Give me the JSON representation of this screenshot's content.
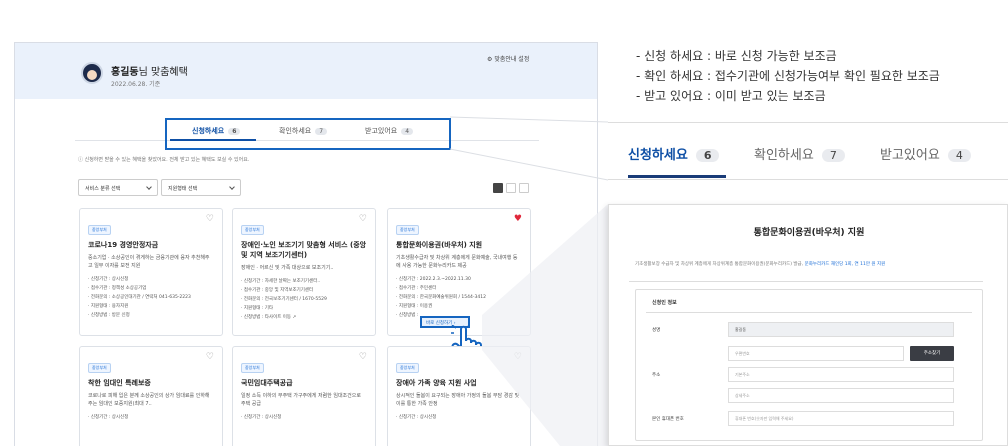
{
  "screen": {
    "header": {
      "name": "홍길동",
      "name_suffix": "님 맞춤혜택",
      "date": "2022.06.28. 기준",
      "guide_link": "맞춤안내 설정"
    },
    "tabs": [
      {
        "label": "신청하세요",
        "count": "6"
      },
      {
        "label": "확인하세요",
        "count": "7"
      },
      {
        "label": "받고있어요",
        "count": "4"
      }
    ],
    "notice": "ⓘ 신청하면 받을 수 있는 혜택을 찾았어요. 전체 받고 있는 혜택도 보실 수 있어요.",
    "filters": {
      "service": "서비스 분류 선택",
      "support": "지원형태 선택"
    },
    "cards": [
      {
        "tag": "중앙부처",
        "title": "코로나19 경영안정자금",
        "desc": "중소기업 · 소상공인이 겪게하는 금융기관에 융자 추천해주고 일부 이자를 보전 지원",
        "rows": [
          "· 신청기간 : 상시신청",
          "· 접수기관 : 정책성 소상공기업",
          "· 전화문의 : 소상공인대기관 / 연락처 041-635-2223",
          "· 지원형태 : 융자지원",
          "· 신청방법 : 방문 신청"
        ]
      },
      {
        "tag": "중앙부처",
        "title": "장애인·노인 보조기기 맞춤형 서비스 (중앙 및 지역 보조기기센터)",
        "desc": "장애인 · 어르신 및 가족 대상으로 보조기기..",
        "rows": [
          "· 신청기간 : 자세한 날짜는 보조기기센터..",
          "· 접수기관 : 중앙 및 지역보조기기센터",
          "· 전화문의 : 전국보조기기센터 / 1670-5529",
          "· 지원형태 : 기타",
          "· 신청방법 : 타사이트 이동 ↗"
        ]
      },
      {
        "tag": "중앙부처",
        "title": "통합문화이용권(바우처) 지원",
        "desc": "기초생활수급자 및 차상위 계층에게 문화예술, 국내여행 등에 사용 가능한 문화누리카드 제공",
        "rows": [
          "· 신청기간 : 2022.2.3.~2022.11.30",
          "· 접수기관 : 주민센터",
          "· 전화문의 : 한국문화예술위원회 / 1544-3412",
          "· 지원형태 : 이용권",
          "· 신청방법 : "
        ],
        "apply_btn": "바로 신청하기 ›",
        "liked": true
      },
      {
        "tag": "중앙부처",
        "title": "착한 임대인 특례보증",
        "desc": "코로나로 피해 입은 분께 소상공인의 상가 임대료를 인하해주는 임대인 보증지원(최대 7..",
        "rows": [
          "· 신청기간 : 상시신청"
        ]
      },
      {
        "tag": "중앙부처",
        "title": "국민임대주택공급",
        "desc": "일정 소득 이하의 무주택 가구주에게 저렴한 임대조건으로 주택 공급",
        "rows": [
          "· 신청기간 : 상시신청"
        ]
      },
      {
        "tag": "중앙부처",
        "title": "장애아 가족 양육 지원 사업",
        "desc": "상시적인 돌봄이 요구되는 장애아 가정의 돌봄 부담 경감 및 이를 통한 가족 안정",
        "rows": [
          "· 신청기간 : 상시신청"
        ]
      }
    ]
  },
  "explanations": [
    "- 신청 하세요 : 바로 신청 가능한 보조금",
    "- 확인 하세요 : 접수기관에 신청가능여부 확인 필요한 보조금",
    "- 받고 있어요 : 이미 받고 있는 보조금"
  ],
  "zoom_tabs": [
    {
      "label": "신청하세요",
      "count": "6"
    },
    {
      "label": "확인하세요",
      "count": "7"
    },
    {
      "label": "받고있어요",
      "count": "4"
    }
  ],
  "detail": {
    "title": "통합문화이용권(바우처) 지원",
    "sub": "기초생활보장 수급자 및 차상위 계층에게 차상위계층 통합문화이용권(문화누리카드) 발급,",
    "sub_link": "문화누리카드 재인당 1회, 연 11만 원 지원",
    "section": "신청인 정보",
    "labels": {
      "name": "성명",
      "address": "주소",
      "phone": "본인 휴대폰 번호"
    },
    "values": {
      "name": "홍길동"
    },
    "placeholders": {
      "zip": "우편번호",
      "addr1": "기본주소",
      "addr2": "상세주소",
      "phone": "휴대폰 번호(숫자만 입력해 주세요)"
    },
    "search_btn": "주소찾기"
  },
  "colors": {
    "accent": "#0e4fa5",
    "highlight": "#1565c0",
    "header_bg": "#eaf1fb",
    "heart": "#e0283b"
  }
}
